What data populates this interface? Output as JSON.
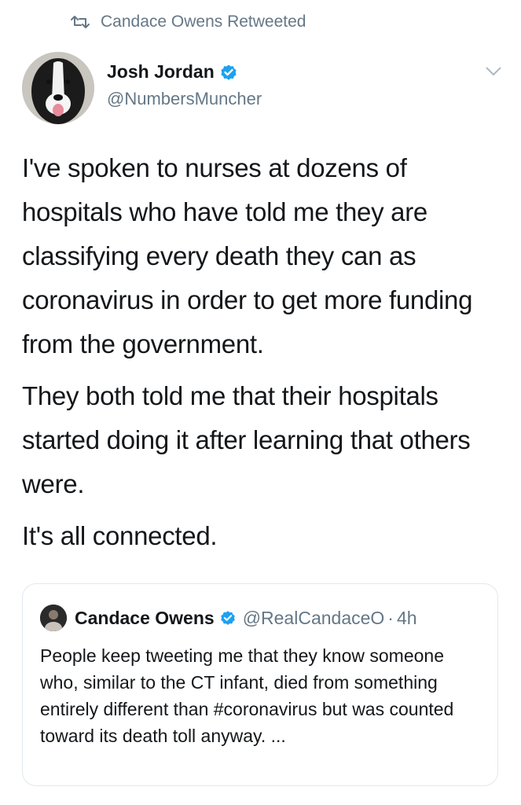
{
  "retweet_context": {
    "text": "Candace Owens Retweeted"
  },
  "author": {
    "name": "Josh Jordan",
    "handle": "@NumbersMuncher"
  },
  "tweet": {
    "paragraphs": [
      "I've spoken to nurses at dozens of hospitals who have told me they are classifying every death they can as coronavirus in order to get more funding from the government.",
      "They both told me that their hospitals started doing it after learning that others were.",
      "It's all connected."
    ]
  },
  "quoted_tweet": {
    "name": "Candace Owens",
    "handle": "@RealCandaceO",
    "separator": "·",
    "time": "4h",
    "text": "People keep tweeting me that they know someone who, similar to the CT infant, died from something entirely different than #coronavirus but was counted toward its death toll anyway. ..."
  },
  "colors": {
    "verified": "#1da1f2",
    "secondary_text": "#657786",
    "border": "#e1e8ed"
  }
}
